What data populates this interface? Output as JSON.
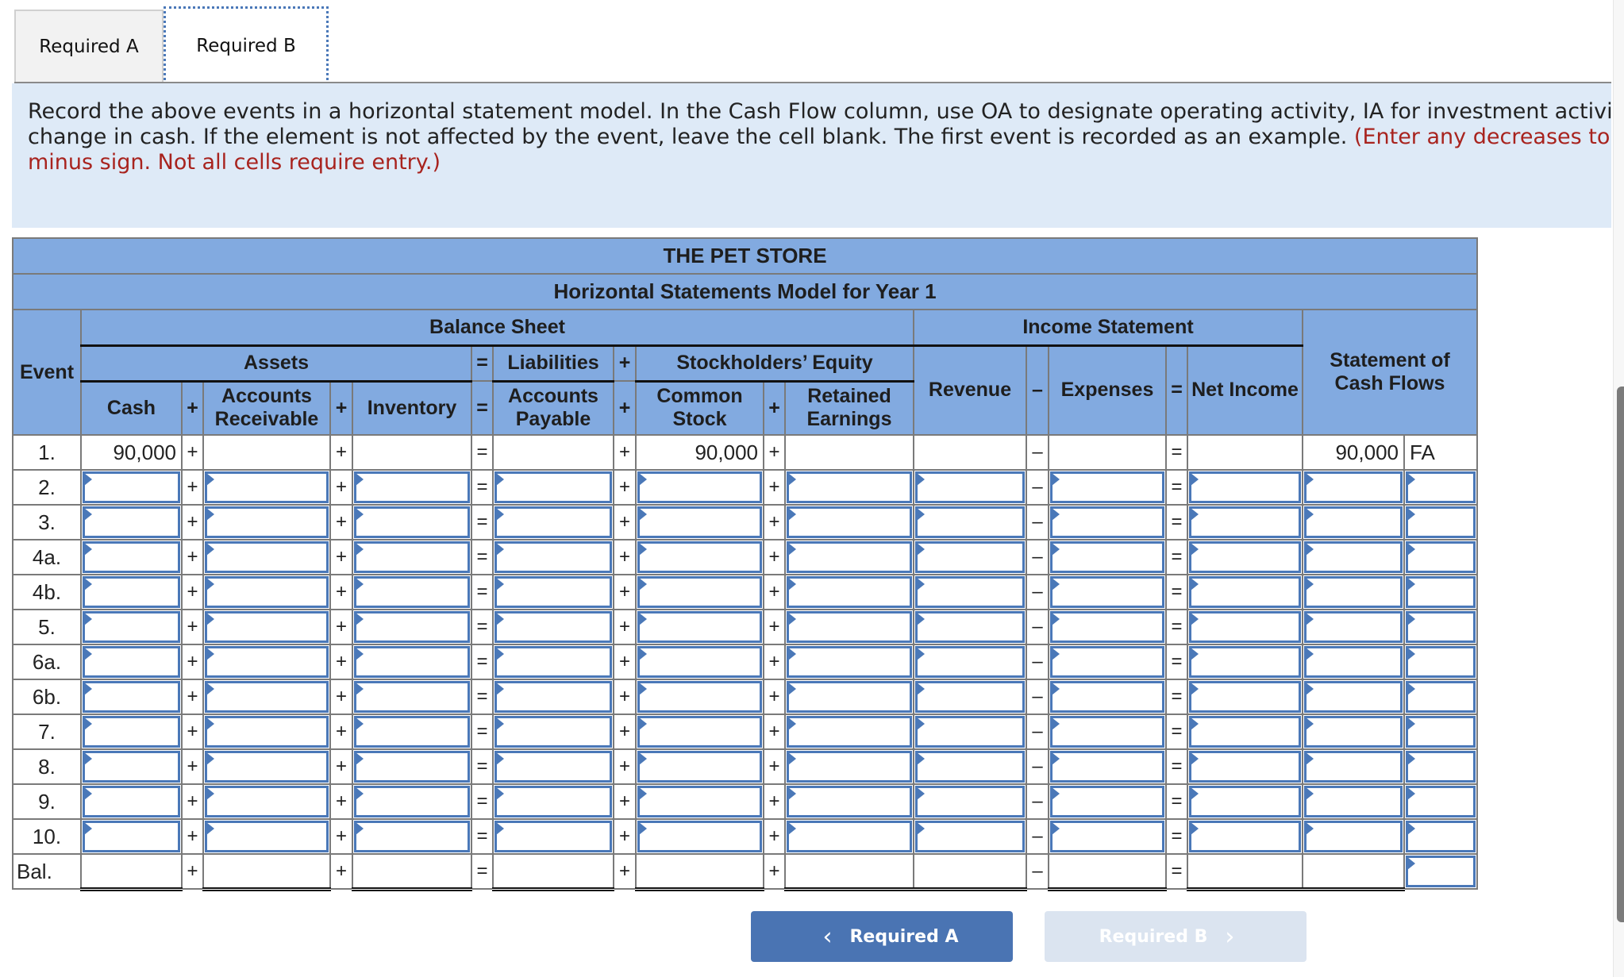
{
  "tabs": [
    {
      "label": "Required A",
      "active": false
    },
    {
      "label": "Required B",
      "active": true
    }
  ],
  "instructions": {
    "line1": "Record the above events in a horizontal statement model. In the Cash Flow column, use OA to designate operating activity, IA for investment activity, FA",
    "line2_black": "change in cash. If the element is not affected by the event, leave the cell blank. The first event is recorded as an example. ",
    "line2_red": "(Enter any decreases to accou",
    "line3_red": "minus sign. Not all cells require entry.)"
  },
  "table": {
    "title": "THE PET STORE",
    "subtitle": "Horizontal Statements Model for Year 1",
    "event_header": "Event",
    "balance_sheet": "Balance Sheet",
    "income_statement": "Income Statement",
    "cash_flows_header": "Statement of Cash Flows",
    "groups": {
      "assets": "Assets",
      "liabilities": "Liabilities",
      "equity": "Stockholders’ Equity"
    },
    "columns": {
      "cash": "Cash",
      "ar": "Accounts Receivable",
      "inventory": "Inventory",
      "ap": "Accounts Payable",
      "common_stock": "Common Stock",
      "retained_earnings": "Retained Earnings",
      "revenue": "Revenue",
      "expenses": "Expenses",
      "net_income": "Net Income"
    },
    "ops": {
      "plus": "+",
      "equals": "=",
      "minus": "–"
    },
    "example_row": {
      "event": "1.",
      "cash": "90,000",
      "common_stock": "90,000",
      "cash_flow_amount": "90,000",
      "cash_flow_code": "FA"
    },
    "input_rows": [
      "2.",
      "3.",
      "4a.",
      "4b.",
      "5.",
      "6a.",
      "6b.",
      "7.",
      "8.",
      "9.",
      "10."
    ],
    "balance_row_label": "Bal."
  },
  "nav": {
    "prev_label": "Required A",
    "next_label": "Required B",
    "prev_icon": "chevron-left-icon",
    "next_icon": "chevron-right-icon"
  },
  "colors": {
    "header_blue": "#82aae0",
    "input_border": "#4a78b8",
    "instruction_bg": "#deeaf7",
    "red_text": "#a8231e",
    "button_primary": "#4a74b3",
    "button_disabled": "#dbe4f0"
  }
}
